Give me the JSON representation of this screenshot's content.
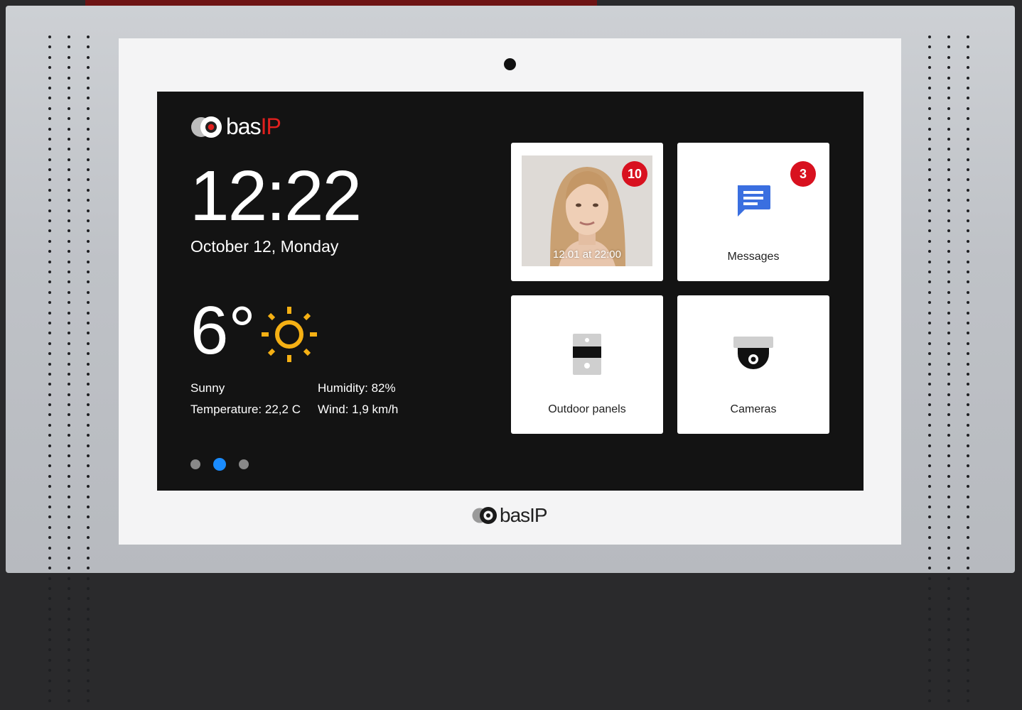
{
  "brand": {
    "name": "bas",
    "name_suffix": "IP",
    "brand_red": "#e0201e"
  },
  "home": {
    "time": "12:22",
    "date": "October 12, Monday"
  },
  "weather": {
    "temperature": "6°",
    "icon": "sun-icon",
    "condition": "Sunny",
    "temperature_detail": "Temperature: 22,2 C",
    "humidity": "Humidity: 82%",
    "wind": "Wind: 1,9 km/h",
    "sun_color": "#f5b014"
  },
  "pagination": {
    "pages": 3,
    "active_index": 1,
    "active_color": "#1a8cff"
  },
  "tiles": {
    "call_log": {
      "caption": "12.01 at 22:00",
      "badge": "10"
    },
    "messages": {
      "label": "Messages",
      "badge": "3",
      "icon": "message-icon",
      "icon_color": "#3a6fe0"
    },
    "outdoor_panels": {
      "label": "Outdoor panels",
      "icon": "outdoor-panel-icon"
    },
    "cameras": {
      "label": "Cameras",
      "icon": "dome-camera-icon"
    }
  },
  "badge_color": "#d8111f"
}
